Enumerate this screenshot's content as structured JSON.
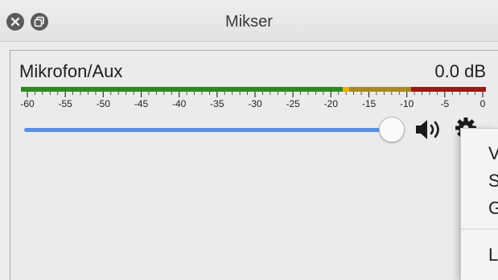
{
  "window": {
    "title": "Mikser"
  },
  "mixer": {
    "source_name": "Mikrofon/Aux",
    "level": "0.0 dB",
    "scale_labels": [
      "-60",
      "-55",
      "-50",
      "-45",
      "-40",
      "-35",
      "-30",
      "-25",
      "-20",
      "-15",
      "-10",
      "-5",
      "0"
    ],
    "volume_fraction": 1.0,
    "meter_colors": {
      "green": "#2f8a1e",
      "yellow": "#a88a1e",
      "red": "#9d1a13"
    },
    "slider_color": "#5b8ee6"
  },
  "context_menu": {
    "items": [
      "V",
      "S",
      "G",
      "L"
    ]
  },
  "icons": {
    "close": "close-icon",
    "restore": "restore-icon",
    "speaker": "speaker-icon",
    "gear": "gear-icon"
  }
}
